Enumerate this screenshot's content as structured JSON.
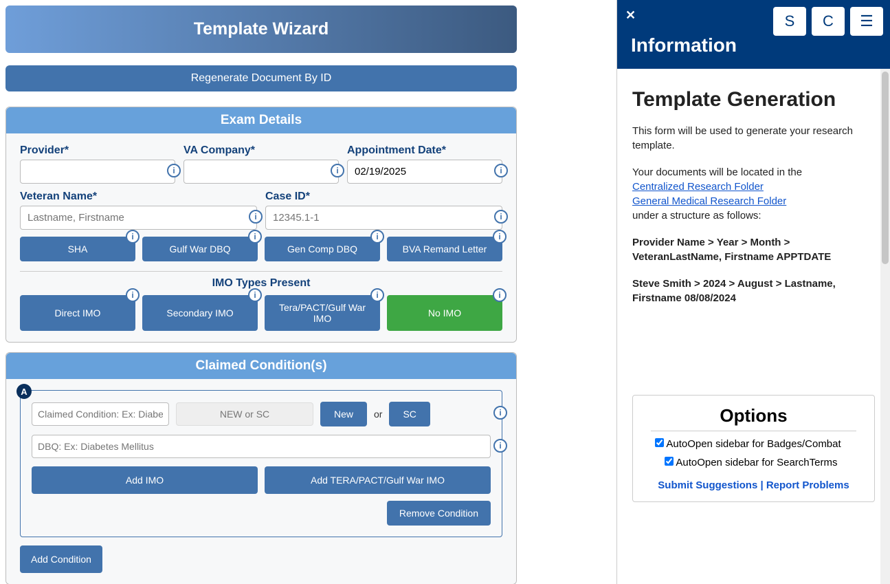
{
  "left": {
    "title": "Template Wizard",
    "regen_btn": "Regenerate Document By ID",
    "exam": {
      "header": "Exam Details",
      "provider_label": "Provider*",
      "va_company_label": "VA Company*",
      "appt_date_label": "Appointment Date*",
      "appt_date_value": "02/19/2025",
      "veteran_name_label": "Veteran Name*",
      "veteran_placeholder": "Lastname, Firstname",
      "case_id_label": "Case ID*",
      "case_id_placeholder": "12345.1-1",
      "btn_sha": "SHA",
      "btn_gulf": "Gulf War DBQ",
      "btn_gencomp": "Gen Comp DBQ",
      "btn_bva": "BVA Remand Letter",
      "imo_types_label": "IMO Types Present",
      "btn_direct_imo": "Direct IMO",
      "btn_secondary_imo": "Secondary IMO",
      "btn_tera_imo": "Tera/PACT/Gulf War IMO",
      "btn_no_imo": "No IMO"
    },
    "claimed": {
      "header": "Claimed Condition(s)",
      "badge": "A",
      "claimed_placeholder": "Claimed Condition: Ex: Diabetes Mellitus",
      "newsc_placeholder": "NEW or SC",
      "btn_new": "New",
      "or_text": "or",
      "btn_sc": "SC",
      "dbq_placeholder": "DBQ: Ex: Diabetes Mellitus",
      "btn_add_imo": "Add IMO",
      "btn_add_tera": "Add TERA/PACT/Gulf War IMO",
      "btn_remove": "Remove Condition",
      "btn_add_condition": "Add Condition"
    }
  },
  "right": {
    "close": "✕",
    "title": "Information",
    "btn_s": "S",
    "btn_c": "C",
    "btn_menu": "☰",
    "body": {
      "heading": "Template Generation",
      "p1": "This form will be used to generate your research template.",
      "p2_pre": "Your documents will be located in the",
      "link1": "Centralized Research Folder",
      "link2": "General Medical Research Folder",
      "p2_post": "under a structure as follows:",
      "path_template": "Provider Name > Year > Month > VeteranLastName, Firstname APPTDATE",
      "path_example": "Steve Smith > 2024 > August > Lastname, Firstname 08/08/2024",
      "options": {
        "heading": "Options",
        "opt1": "AutoOpen sidebar for Badges/Combat",
        "opt2": "AutoOpen sidebar for SearchTerms",
        "submit_link": "Submit Suggestions | Report Problems"
      }
    }
  }
}
